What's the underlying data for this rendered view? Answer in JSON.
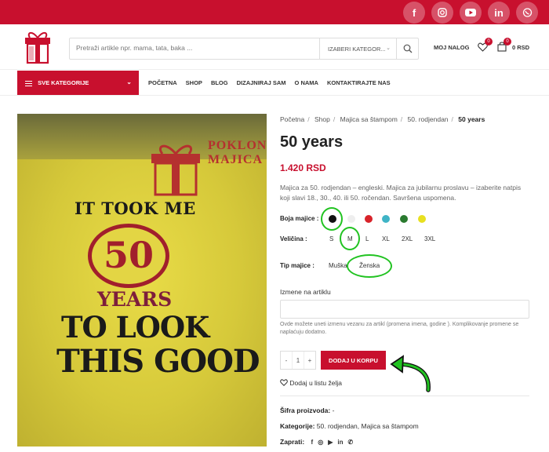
{
  "social": [
    "f",
    "ig",
    "yt",
    "in",
    "viber"
  ],
  "search": {
    "placeholder": "Pretraži artikle npr. mama, tata, baka ...",
    "category": "IZABERI KATEGOR..."
  },
  "header": {
    "account": "MOJ NALOG",
    "wishlist_count": "0",
    "cart_count": "0",
    "cart_total": "0 RSD"
  },
  "nav": {
    "all_categories": "SVE KATEGORIJE",
    "items": [
      "POČETNA",
      "SHOP",
      "BLOG",
      "DIZAJNIRAJ SAM",
      "O NAMA",
      "KONTAKTIRAJTE NAS"
    ]
  },
  "breadcrumb": [
    "Početna",
    "Shop",
    "Majica sa štampom",
    "50. rodjendan",
    "50 years"
  ],
  "product": {
    "title": "50 years",
    "price": "1.420 RSD",
    "description": "Majica za 50. rodjendan – engleski. Majica za jubilarnu proslavu – izaberite natpis koji slavi 18., 30., 40. ili 50. ročendan. Savršena uspomena.",
    "color_label": "Boja majice :",
    "colors": [
      "#111111",
      "#eeeeee",
      "#d8232a",
      "#3fb4c6",
      "#2a7a2f",
      "#e8e020"
    ],
    "size_label": "Veličina :",
    "sizes": [
      "S",
      "M",
      "L",
      "XL",
      "2XL",
      "3XL"
    ],
    "type_label": "Tip majice :",
    "types": [
      "Muška",
      "Ženska"
    ],
    "edit_label": "Izmene na artiklu",
    "edit_help": "Ovde možete uneti izmenu vezanu za artikl (promena imena, godine ). Komplikovanje promene se naplaćuju dodatno.",
    "qty_minus": "-",
    "qty": "1",
    "qty_plus": "+",
    "add_to_cart": "DODAJ U KORPU",
    "add_wishlist": "Dodaj u listu želja",
    "sku_label": "Šifra proizvoda:",
    "sku": "-",
    "cats_label": "Kategorije:",
    "cats": "50. rodjendan, Majica sa štampom",
    "share_label": "Zaprati:"
  },
  "image": {
    "brand_top": "POKLON",
    "brand_bottom": "MAJICA",
    "line1": "IT TOOK ME",
    "number": "50",
    "line2": "YEARS",
    "line3": "TO LOOK",
    "line4": "THIS GOOD"
  },
  "colors": {
    "accent": "#c8102e",
    "highlight": "#22c322"
  }
}
